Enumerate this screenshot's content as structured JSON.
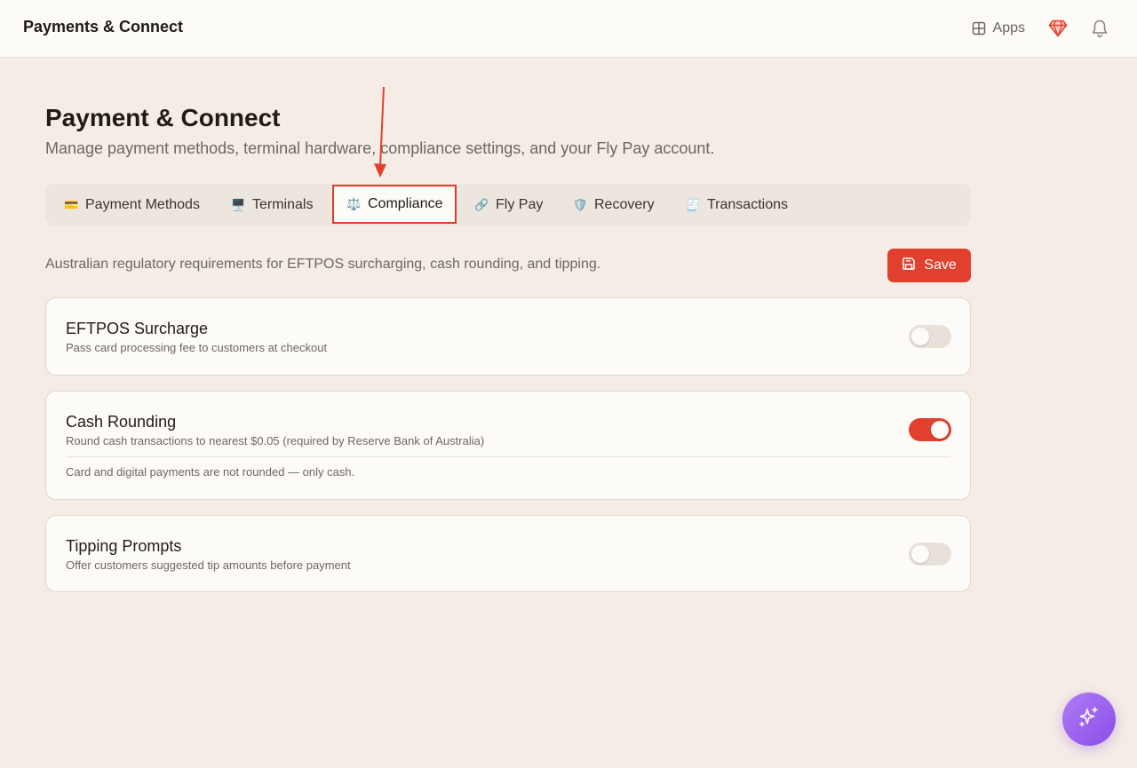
{
  "topbar": {
    "app_title": "Payments & Connect",
    "apps_label": "Apps",
    "icons": {
      "apps": "grid-icon",
      "premium": "gem-icon",
      "notifications": "bell-icon"
    }
  },
  "header": {
    "title": "Payment & Connect",
    "subtitle": "Manage payment methods, terminal hardware, compliance settings, and your Fly Pay account."
  },
  "tabs": [
    {
      "label": "Payment Methods",
      "icon": "💳"
    },
    {
      "label": "Terminals",
      "icon": "🖥️"
    },
    {
      "label": "Compliance",
      "icon": "⚖️"
    },
    {
      "label": "Fly Pay",
      "icon": "🔗"
    },
    {
      "label": "Recovery",
      "icon": "🛡️"
    },
    {
      "label": "Transactions",
      "icon": "🧾"
    }
  ],
  "active_tab": "Compliance",
  "section": {
    "description": "Australian regulatory requirements for EFTPOS surcharging, cash rounding, and tipping.",
    "save_label": "Save"
  },
  "settings": [
    {
      "title": "EFTPOS Surcharge",
      "subtitle": "Pass card processing fee to customers at checkout",
      "enabled": false
    },
    {
      "title": "Cash Rounding",
      "subtitle": "Round cash transactions to nearest $0.05 (required by Reserve Bank of Australia)",
      "note": "Card and digital payments are not rounded — only cash.",
      "enabled": true
    },
    {
      "title": "Tipping Prompts",
      "subtitle": "Offer customers suggested tip amounts before payment",
      "enabled": false
    }
  ],
  "colors": {
    "accent": "#e0402d",
    "background": "#f5ede5",
    "highlight_border": "#e03b2b",
    "assistant_gradient_start": "#b07cf5",
    "assistant_gradient_end": "#8a4de8"
  }
}
